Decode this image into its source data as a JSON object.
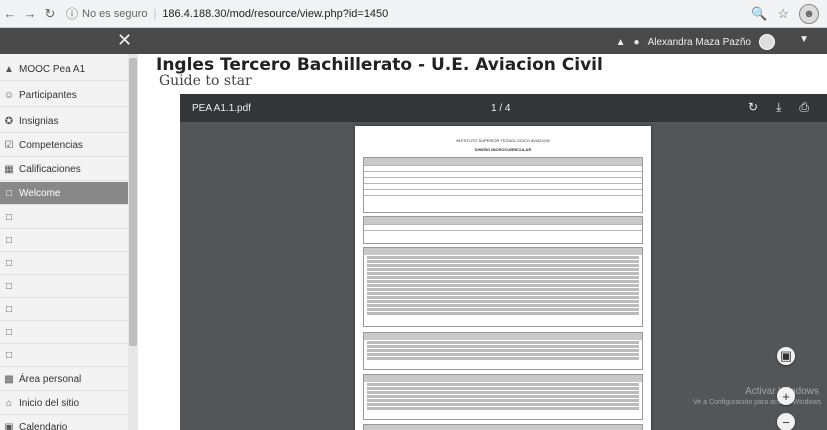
{
  "browser": {
    "back_icon": "arrow-left-icon",
    "forward_icon": "arrow-right-icon",
    "reload_icon": "reload-icon",
    "security_label": "No es seguro",
    "url": "186.4.188.30/mod/resource/view.php?id=1450"
  },
  "navbar": {
    "user_name": "Alexandra Maza Pazño"
  },
  "sidebar": {
    "items": [
      {
        "label": "MOOC Pea A1",
        "icon": "mortarboard-icon",
        "active": false
      },
      {
        "label": "Participantes",
        "icon": "users-icon",
        "active": false
      },
      {
        "label": "Insignias",
        "icon": "badge-icon",
        "active": false
      },
      {
        "label": "Competencias",
        "icon": "checklist-icon",
        "active": false
      },
      {
        "label": "Calificaciones",
        "icon": "grades-icon",
        "active": false
      },
      {
        "label": "Welcome",
        "icon": "folder-icon",
        "active": true
      },
      {
        "label": "",
        "icon": "folder-icon",
        "active": false
      },
      {
        "label": "",
        "icon": "folder-icon",
        "active": false
      },
      {
        "label": "",
        "icon": "folder-icon",
        "active": false
      },
      {
        "label": "",
        "icon": "folder-icon",
        "active": false
      },
      {
        "label": "",
        "icon": "folder-icon",
        "active": false
      },
      {
        "label": "",
        "icon": "folder-icon",
        "active": false
      },
      {
        "label": "",
        "icon": "folder-icon",
        "active": false
      },
      {
        "label": "Área personal",
        "icon": "dashboard-icon",
        "active": false
      },
      {
        "label": "Inicio del sitio",
        "icon": "home-icon",
        "active": false
      },
      {
        "label": "Calendario",
        "icon": "calendar-icon",
        "active": false
      }
    ]
  },
  "main": {
    "title": "Ingles Tercero Bachillerato - U.E. Aviacion Civil",
    "subtitle": "Guide to star"
  },
  "viewer": {
    "file_name": "PEA A1.1.pdf",
    "page_indicator": "1 / 4",
    "doc_header": "INSTITUTO SUPERIOR TECNOLOGICO AVIACION",
    "doc_title": "DISEÑO MICROCURRICULAR",
    "watermark_line1": "Activar Windows",
    "watermark_line2": "Ve a Configuración para activar Windows"
  },
  "colors": {
    "navbar": "#4a4a4a",
    "sidebar_active": "#888888",
    "viewer_bg": "#525659",
    "viewer_toolbar": "#323639"
  }
}
